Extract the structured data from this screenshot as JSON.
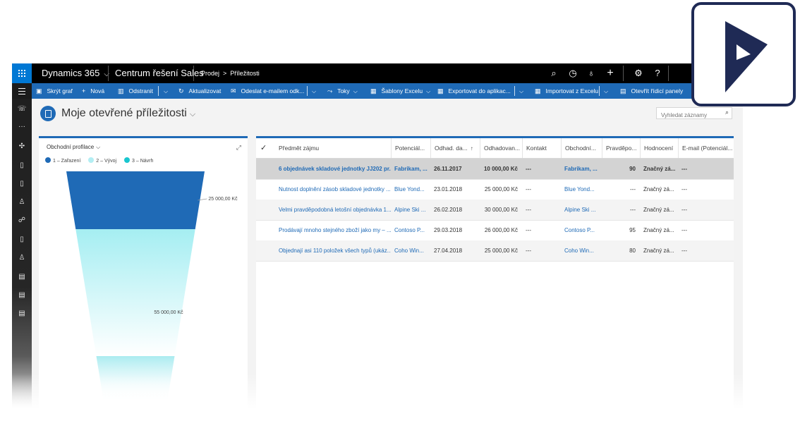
{
  "topbar": {
    "brand": "Dynamics 365",
    "app_name": "Centrum řešení Sales",
    "breadcrumb": [
      "Prodej",
      "Příležitosti"
    ],
    "icons": [
      "search-icon",
      "task-icon",
      "lightbulb-icon",
      "plus-icon",
      "gear-icon",
      "help-icon"
    ]
  },
  "commands": [
    {
      "label": "Skrýt graf",
      "icon": "chart-icon"
    },
    {
      "label": "Nová",
      "icon": "plus-icon"
    },
    {
      "label": "Odstranit",
      "icon": "trash-icon"
    },
    {
      "label": "Aktualizovat",
      "icon": "refresh-icon"
    },
    {
      "label": "Odeslat e-mailem odk...",
      "icon": "email-icon"
    },
    {
      "label": "Toky",
      "icon": "flow-icon"
    },
    {
      "label": "Šablony Excelu",
      "icon": "excel-template-icon"
    },
    {
      "label": "Exportovat do aplikac...",
      "icon": "excel-export-icon"
    },
    {
      "label": "Importovat z Excelu",
      "icon": "excel-import-icon"
    },
    {
      "label": "Otevřít řídicí panely",
      "icon": "dashboard-icon"
    }
  ],
  "view": {
    "title": "Moje otevřené příležitosti",
    "search_placeholder": "Vyhledat záznamy"
  },
  "chart": {
    "header": "Obchodní profilace",
    "legend": [
      {
        "label": "1 – Zařazení",
        "color": "#1f6ab6"
      },
      {
        "label": "2 – Vývoj",
        "color": "#b3eef3"
      },
      {
        "label": "3 – Návrh",
        "color": "#19c6cf"
      }
    ]
  },
  "chart_data": {
    "type": "funnel",
    "categories": [
      "1 – Zařazení",
      "2 – Vývoj",
      "3 – Návrh"
    ],
    "values": [
      25000,
      55000,
      0
    ],
    "data_labels": [
      "25 000,00 Kč",
      "55 000,00 Kč",
      ""
    ]
  },
  "grid": {
    "columns": [
      "Předmět zájmu",
      "Potenciál...",
      "Odhad. da...",
      "Odhadovan...",
      "Kontakt",
      "Obchodní...",
      "Pravděpo...",
      "Hodnocení",
      "E-mail (Potenciál..."
    ],
    "rows": [
      [
        "6 objednávek skladové jednotky JJ202 pr...",
        "Fabrikam, ...",
        "26.11.2017",
        "10 000,00 Kč",
        "---",
        "Fabrikam, ...",
        "90",
        "Značný zá...",
        "---"
      ],
      [
        "Nutnost doplnění zásob skladové jednotky ...",
        "Blue Yond...",
        "23.01.2018",
        "25 000,00 Kč",
        "---",
        "Blue Yond...",
        "---",
        "Značný zá...",
        "---"
      ],
      [
        "Velmi pravděpodobná letošní objednávka 1...",
        "Alpine Ski ...",
        "26.02.2018",
        "30 000,00 Kč",
        "---",
        "Alpine Ski ...",
        "---",
        "Značný zá...",
        "---"
      ],
      [
        "Prodávají mnoho stejného zboží jako my – ...",
        "Contoso P...",
        "29.03.2018",
        "26 000,00 Kč",
        "---",
        "Contoso P...",
        "95",
        "Značný zá...",
        "---"
      ],
      [
        "Objednají asi 110 položek všech typů (ukáz...",
        "Coho Win...",
        "27.04.2018",
        "25 000,00 Kč",
        "---",
        "Coho Win...",
        "80",
        "Značný zá...",
        "---"
      ]
    ]
  },
  "logo": {
    "name": "dynamics-365-logo",
    "color": "#1f2a55"
  }
}
